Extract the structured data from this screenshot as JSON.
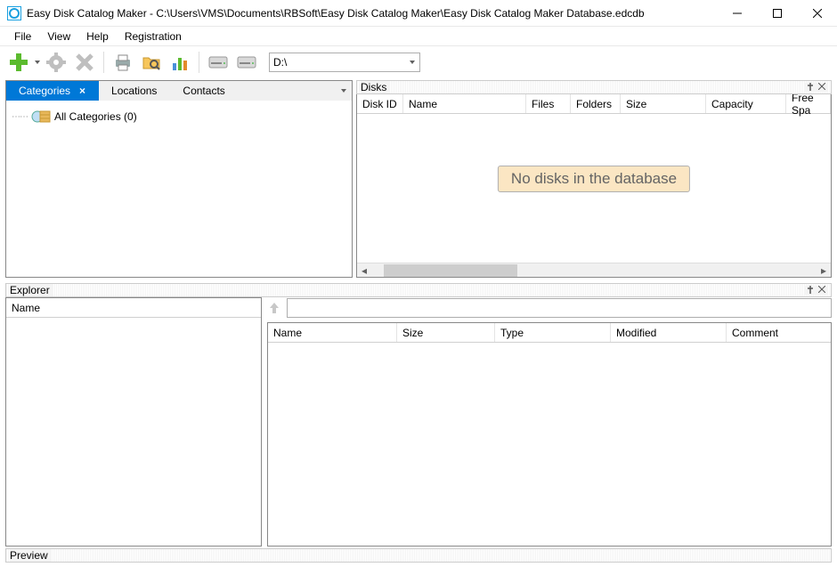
{
  "window": {
    "title": "Easy Disk Catalog Maker - C:\\Users\\VMS\\Documents\\RBSoft\\Easy Disk Catalog Maker\\Easy Disk Catalog Maker Database.edcdb"
  },
  "menu": {
    "file": "File",
    "view": "View",
    "help": "Help",
    "registration": "Registration"
  },
  "toolbar": {
    "drive": "D:\\"
  },
  "leftTabs": {
    "categories": "Categories",
    "locations": "Locations",
    "contacts": "Contacts"
  },
  "tree": {
    "allCategories": "All Categories (0)"
  },
  "disksPane": {
    "title": "Disks",
    "cols": {
      "diskId": "Disk ID",
      "name": "Name",
      "files": "Files",
      "folders": "Folders",
      "size": "Size",
      "capacity": "Capacity",
      "freeSpace": "Free Spa"
    },
    "empty": "No disks in the database"
  },
  "explorer": {
    "title": "Explorer",
    "leftCols": {
      "name": "Name"
    },
    "rightCols": {
      "name": "Name",
      "size": "Size",
      "type": "Type",
      "modified": "Modified",
      "comment": "Comment"
    }
  },
  "preview": {
    "title": "Preview"
  }
}
